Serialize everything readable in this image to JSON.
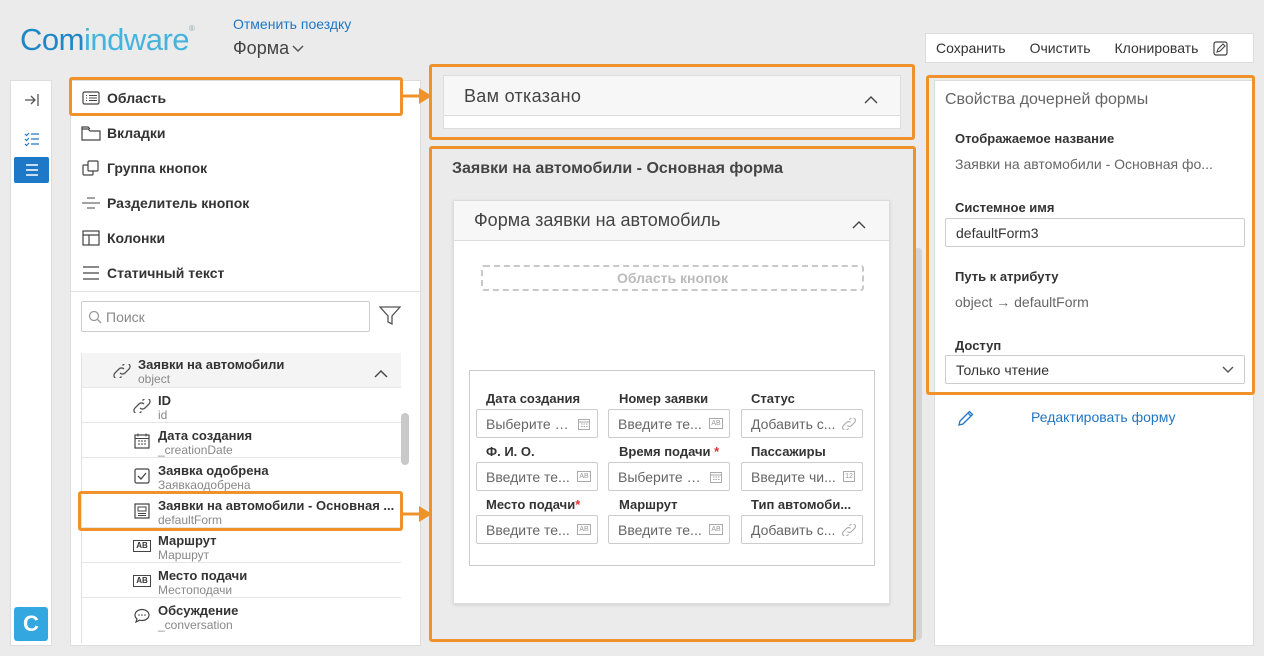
{
  "header": {
    "logo_part1": "Com",
    "logo_part2": "indware",
    "logo_reg": "®",
    "cancel_link": "Отменить поездку",
    "form_dropdown": "Форма"
  },
  "toolbar": {
    "save": "Сохранить",
    "clear": "Очистить",
    "clone": "Клонировать"
  },
  "rail": {
    "logo_letter": "C"
  },
  "palette": {
    "items": [
      {
        "label": "Область",
        "icon": "area-icon"
      },
      {
        "label": "Вкладки",
        "icon": "tabs-icon"
      },
      {
        "label": "Группа кнопок",
        "icon": "button-group-icon"
      },
      {
        "label": "Разделитель кнопок",
        "icon": "button-separator-icon"
      },
      {
        "label": "Колонки",
        "icon": "columns-icon"
      },
      {
        "label": "Статичный текст",
        "icon": "static-text-icon"
      }
    ],
    "search_placeholder": "Поиск"
  },
  "tree": {
    "root": {
      "title": "Заявки на автомобили",
      "sub": "object"
    },
    "rows": [
      {
        "title": "ID",
        "sub": "id",
        "icon": "link-icon"
      },
      {
        "title": "Дата создания",
        "sub": "_creationDate",
        "icon": "calendar-icon"
      },
      {
        "title": "Заявка одобрена",
        "sub": "Заявкаодобрена",
        "icon": "checkbox-icon"
      },
      {
        "title": "Заявки на автомобили - Основная ...",
        "sub": "defaultForm",
        "icon": "subform-icon"
      },
      {
        "title": "Маршрут",
        "sub": "Маршрут",
        "icon": "text-ab-icon"
      },
      {
        "title": "Место подачи",
        "sub": "Местоподачи",
        "icon": "text-ab-icon"
      },
      {
        "title": "Обсуждение",
        "sub": "_conversation",
        "icon": "comment-icon"
      }
    ]
  },
  "center": {
    "rejected_title": "Вам отказано",
    "main_title": "Заявки на автомобили - Основная форма",
    "form_title": "Форма заявки на автомобиль",
    "button_area": "Область кнопок",
    "fields": [
      {
        "label": "Дата создания",
        "placeholder": "Выберите д...",
        "icon": "calendar-icon",
        "required": false
      },
      {
        "label": "Номер заявки",
        "placeholder": "Введите те...",
        "icon": "text-ab-icon",
        "required": false
      },
      {
        "label": "Статус",
        "placeholder": "Добавить с...",
        "icon": "link-icon",
        "required": false
      },
      {
        "label": "Ф. И. О.",
        "placeholder": "Введите те...",
        "icon": "text-ab-icon",
        "required": false
      },
      {
        "label": "Время подачи",
        "placeholder": "Выберите д...",
        "icon": "calendar-icon",
        "required": true
      },
      {
        "label": "Пассажиры",
        "placeholder": "Введите чи...",
        "icon": "number-icon",
        "required": false
      },
      {
        "label": "Место подачи",
        "placeholder": "Введите те...",
        "icon": "text-ab-icon",
        "required": true
      },
      {
        "label": "Маршрут",
        "placeholder": "Введите те...",
        "icon": "text-ab-icon",
        "required": false
      },
      {
        "label": "Тип автомоби...",
        "placeholder": "Добавить с...",
        "icon": "link-icon",
        "required": false
      }
    ],
    "required_mark": "*",
    "ab_text": "AB",
    "num_text": "12"
  },
  "props": {
    "title": "Свойства дочерней формы",
    "display_name_label": "Отображаемое название",
    "display_name_value": "Заявки на автомобили - Основная фо...",
    "system_name_label": "Системное имя",
    "system_name_value": "defaultForm3",
    "attr_path_label": "Путь к атрибуту",
    "attr_path_value": "object → defaultForm",
    "access_label": "Доступ",
    "access_value": "Только чтение",
    "edit_form_link": "Редактировать форму"
  },
  "colors": {
    "accent": "#1e78c8",
    "highlight": "#f0922b",
    "link": "#1f77c4"
  }
}
